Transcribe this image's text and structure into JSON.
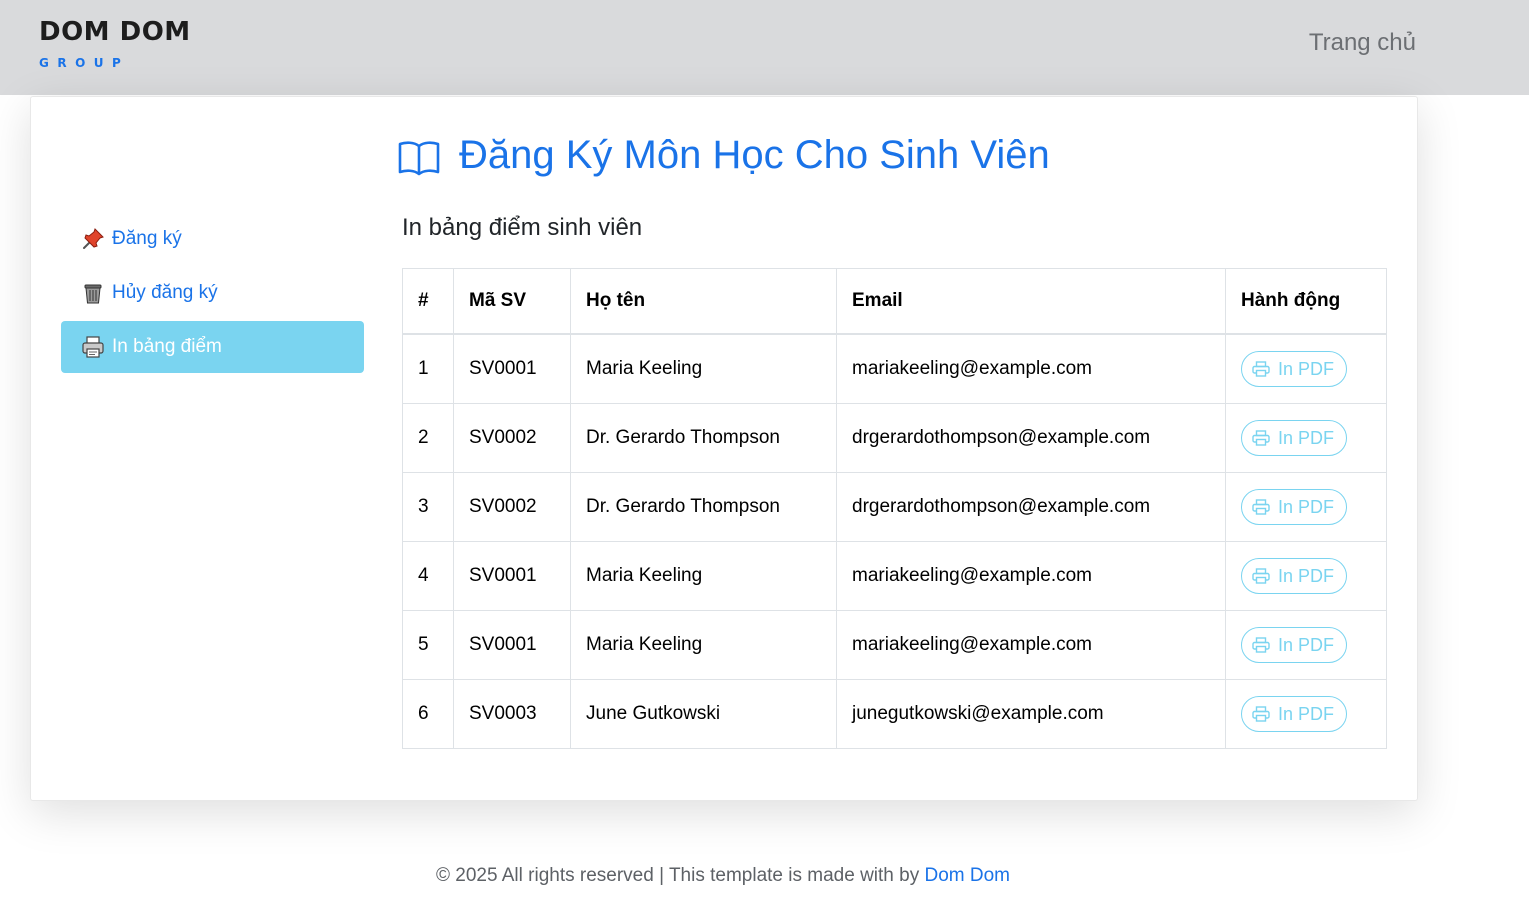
{
  "brand": {
    "name": "DOM DOM",
    "sub": "GROUP"
  },
  "nav": {
    "home": "Trang chủ"
  },
  "page": {
    "title": "Đăng Ký Môn Học Cho Sinh Viên",
    "title_icon": "book-open-icon"
  },
  "sidebar": {
    "items": [
      {
        "label": "Đăng ký",
        "icon": "pushpin-icon",
        "active": false
      },
      {
        "label": "Hủy đăng ký",
        "icon": "trash-can-icon",
        "active": false
      },
      {
        "label": "In bảng điểm",
        "icon": "printer-icon",
        "active": true
      }
    ]
  },
  "section": {
    "title": "In bảng điểm sinh viên"
  },
  "table": {
    "headers": [
      "#",
      "Mã SV",
      "Họ tên",
      "Email",
      "Hành động"
    ],
    "rows": [
      {
        "no": "1",
        "code": "SV0001",
        "name": "Maria Keeling",
        "email": "mariakeeling@example.com",
        "action": "In PDF"
      },
      {
        "no": "2",
        "code": "SV0002",
        "name": "Dr. Gerardo Thompson",
        "email": "drgerardothompson@example.com",
        "action": "In PDF"
      },
      {
        "no": "3",
        "code": "SV0002",
        "name": "Dr. Gerardo Thompson",
        "email": "drgerardothompson@example.com",
        "action": "In PDF"
      },
      {
        "no": "4",
        "code": "SV0001",
        "name": "Maria Keeling",
        "email": "mariakeeling@example.com",
        "action": "In PDF"
      },
      {
        "no": "5",
        "code": "SV0001",
        "name": "Maria Keeling",
        "email": "mariakeeling@example.com",
        "action": "In PDF"
      },
      {
        "no": "6",
        "code": "SV0003",
        "name": "June Gutkowski",
        "email": "junegutkowski@example.com",
        "action": "In PDF"
      }
    ]
  },
  "footer": {
    "text": "© 2025 All rights reserved | This template is made with by ",
    "link": "Dom Dom"
  },
  "colors": {
    "accent": "#1a73e8",
    "active": "#7ad4f0",
    "topbar": "#d9dadc"
  }
}
